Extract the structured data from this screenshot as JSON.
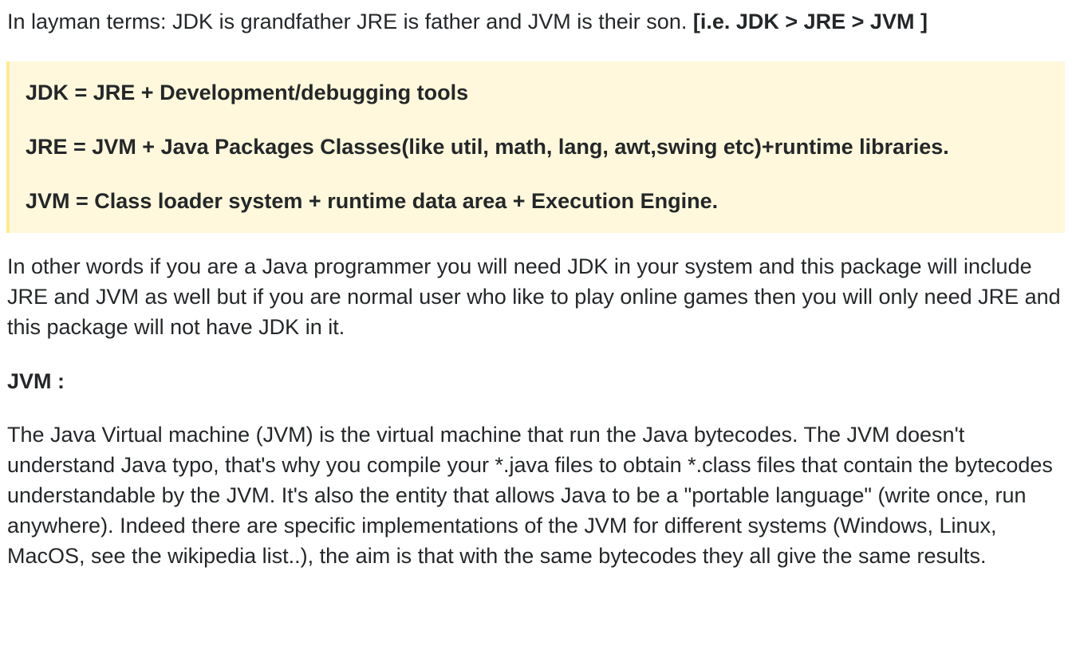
{
  "intro": {
    "text": "In layman terms: JDK is grandfather JRE is father and JVM is their son. ",
    "bold": "[i.e. JDK > JRE > JVM ]"
  },
  "quote": {
    "lines": [
      "JDK = JRE + Development/debugging tools",
      "JRE = JVM + Java Packages Classes(like util, math, lang, awt,swing etc)+runtime libraries.",
      "JVM = Class loader system + runtime data area + Execution Engine."
    ]
  },
  "para1": "In other words if you are a Java programmer you will need JDK in your system and this package will include JRE and JVM as well but if you are normal user who like to play online games then you will only need JRE and this package will not have JDK in it.",
  "heading": "JVM :",
  "para2": "The Java Virtual machine (JVM) is the virtual machine that run the Java bytecodes. The JVM doesn't understand Java typo, that's why you compile your *.java files to obtain *.class files that contain the bytecodes understandable by the JVM. It's also the entity that allows Java to be a \"portable language\" (write once, run anywhere). Indeed there are specific implementations of the JVM for different systems (Windows, Linux, MacOS, see the wikipedia list..), the aim is that with the same bytecodes they all give the same results."
}
